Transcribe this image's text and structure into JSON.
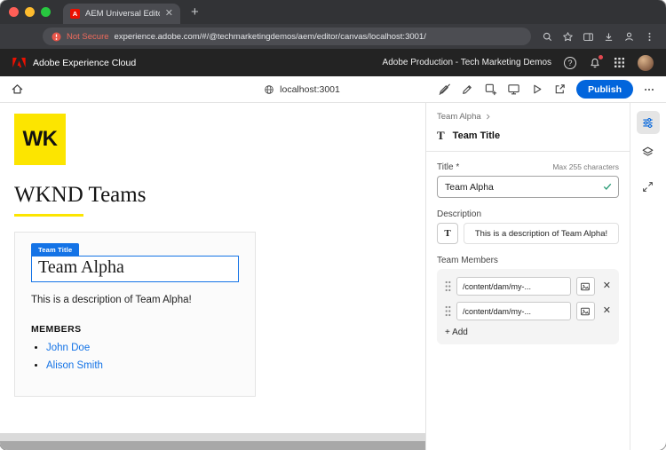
{
  "colors": {
    "accent_blue": "#1473E6",
    "publish_blue": "#0265DC",
    "wknd_yellow": "#FCE500",
    "success_green": "#2D9D78",
    "adobe_red": "#EB1000"
  },
  "browser": {
    "favicon_letter": "A",
    "tab_title": "AEM Universal Editor | Adob...",
    "security_label": "Not Secure",
    "url": "experience.adobe.com/#/@techmarketingdemos/aem/editor/canvas/localhost:3001/"
  },
  "shell": {
    "brand": "Adobe Experience Cloud",
    "org": "Adobe Production - Tech Marketing Demos"
  },
  "toolbar": {
    "host": "localhost:3001",
    "publish_label": "Publish"
  },
  "canvas": {
    "logo_text": "WK",
    "page_title": "WKND Teams",
    "card": {
      "tag": "Team Title",
      "title": "Team Alpha",
      "description": "This is a description of Team Alpha!",
      "members_heading": "MEMBERS",
      "members": [
        "John Doe",
        "Alison Smith"
      ]
    }
  },
  "panel": {
    "breadcrumb": "Team Alpha",
    "component_icon": "T",
    "component_name": "Team Title",
    "title_field": {
      "label": "Title",
      "required": "*",
      "hint": "Max 255 characters",
      "value": "Team Alpha"
    },
    "description_field": {
      "label": "Description",
      "icon": "T",
      "value": "This is a description of Team Alpha!"
    },
    "members_field": {
      "label": "Team Members",
      "paths": [
        "/content/dam/my-...",
        "/content/dam/my-..."
      ],
      "add_label": "+ Add"
    }
  }
}
